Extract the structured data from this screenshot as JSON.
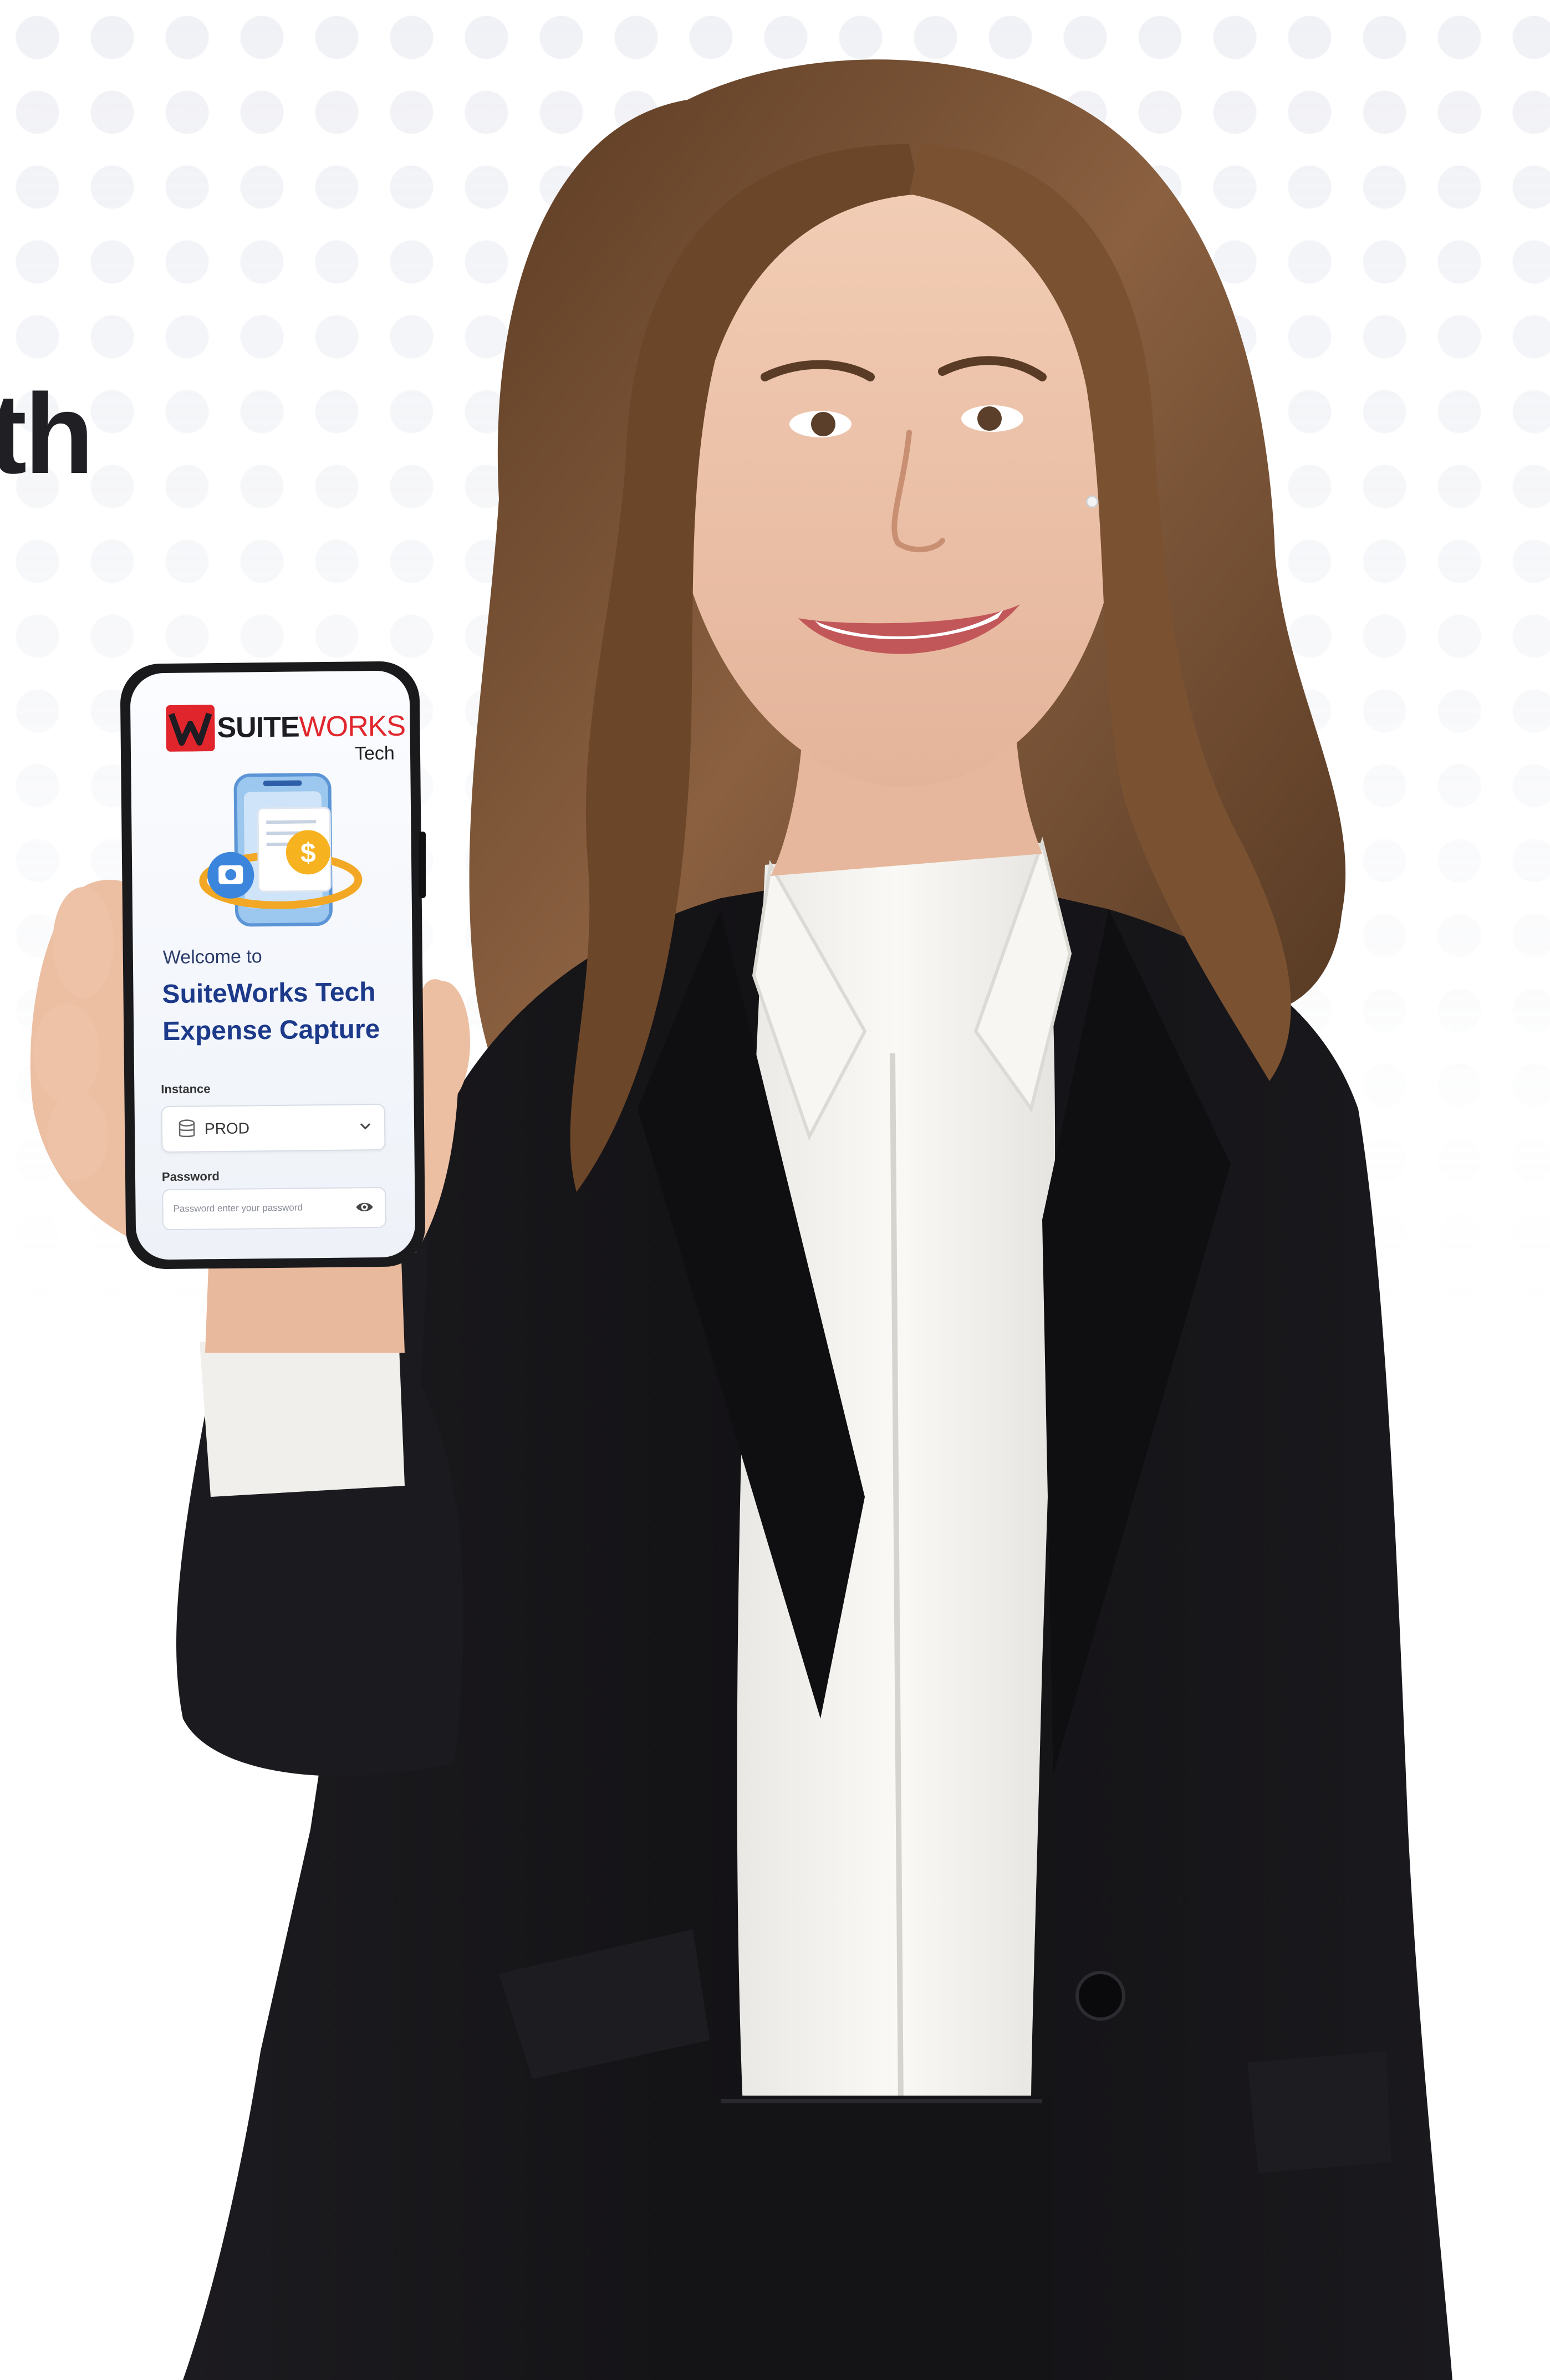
{
  "headline": {
    "text": "th"
  },
  "phone": {
    "brand": {
      "name_primary": "SUITE",
      "name_secondary": "WORKS",
      "sub": "Tech"
    },
    "welcome": "Welcome to",
    "title_line1": "SuiteWorks Tech",
    "title_line2": "Expense Capture",
    "instance_label": "Instance",
    "instance_value": "PROD",
    "password_label": "Password",
    "password_placeholder": "Password enter your password"
  },
  "colors": {
    "brand_red": "#e0262c",
    "title_blue": "#1d3a8a",
    "suit": "#151417",
    "shirt": "#f4f3f0",
    "hair": "#6e4a2e"
  }
}
